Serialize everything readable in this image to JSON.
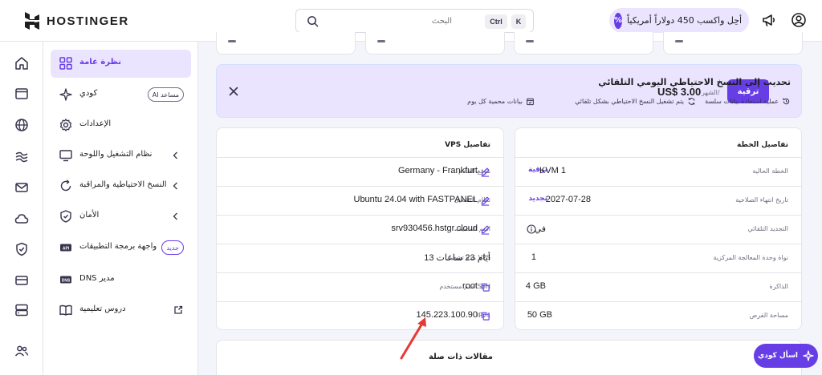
{
  "brand": {
    "name": "HOSTINGER",
    "accent": "#673de6"
  },
  "search": {
    "placeholder": "البحث",
    "shortcut_ctrl": "Ctrl",
    "shortcut_key": "K"
  },
  "promo": {
    "text": "أحِل واكسب 450 دولاراً أمريكياً",
    "icon": "percent-badge-icon"
  },
  "topbar_icons": [
    "megaphone-icon",
    "account-icon"
  ],
  "rail_icons": [
    "home-icon",
    "browser-window-icon",
    "globe-icon",
    "wind-icon",
    "mail-icon",
    "cloud-icon",
    "shield-icon",
    "billing-card-icon",
    "server-icon",
    "users-icon"
  ],
  "sidebar": {
    "items": [
      {
        "label": "نظرة عامة",
        "icon": "overview-grid-icon",
        "active": true
      },
      {
        "label": "كودي",
        "icon": "kodee-sparkle-icon",
        "badge": "مساعد AI"
      },
      {
        "label": "الإعدادات",
        "icon": "settings-gear-icon"
      },
      {
        "label": "نظام التشغيل واللوحة",
        "icon": "monitor-icon",
        "chevron": true
      },
      {
        "label": "النسخ الاحتياطية والمراقبة",
        "icon": "backup-refresh-icon",
        "chevron": true
      },
      {
        "label": "الأمان",
        "icon": "security-shield-icon",
        "chevron": true
      },
      {
        "label": "واجهة برمجة التطبيقات",
        "icon": "api-icon",
        "badge": "جديد"
      },
      {
        "label": "مدير DNS",
        "icon": "dns-icon"
      },
      {
        "label": "دروس تعليمية",
        "icon": "book-icon",
        "external": true
      }
    ]
  },
  "banner": {
    "title": "تحديث إلى النسخ الاحتياطي اليومي التلقائي",
    "features": [
      {
        "text": "عملية استعادة بيانات سلسة",
        "icon": "restore-icon"
      },
      {
        "text": "يتم تشغيل النسخ الاحتياطي بشكل تلقائي",
        "icon": "auto-sync-icon"
      },
      {
        "text": "بيانات محمية كل يوم",
        "icon": "calendar-check-icon"
      }
    ],
    "price": "US$ 3.00",
    "price_period": "/الشهر",
    "button": "ترقية"
  },
  "vps_details": {
    "title": "تفاصيل VPS",
    "rows": [
      {
        "label": "موقع الخادم",
        "value": "Germany - Frankfurt",
        "icon": "edit-pencil-icon"
      },
      {
        "label": "نظام التشغيل",
        "value": "Ubuntu 24.04 with FASTPANEL",
        "icon": "edit-pencil-icon"
      },
      {
        "label": "اسم المضيف",
        "value": "srv930456.hstgr.cloud",
        "icon": "edit-pencil-icon"
      },
      {
        "label": "VPS مدة تشغيل",
        "value": "أيام 23 ساعات 13"
      },
      {
        "label": "SSH اسم مستخدم",
        "value": "root",
        "icon": "copy-icon"
      },
      {
        "label": "IPv4",
        "value": "145.223.100.90",
        "icon": "copy-icon"
      }
    ]
  },
  "plan_details": {
    "title": "تفاصيل الخطة",
    "rows": [
      {
        "label": "الخطة الحالية",
        "value": "KVM 1",
        "action": "ترقية"
      },
      {
        "label": "تاريخ انتهاء الصلاحية",
        "value": "2027-07-28",
        "action": "تجديد"
      },
      {
        "label": "التجديد التلقائي",
        "value": "في",
        "icon": "info-icon"
      },
      {
        "label": "نواة وحدة المعالجة المركزية",
        "value": "1"
      },
      {
        "label": "الذاكرة",
        "value": "4 GB"
      },
      {
        "label": "مساحة القرص",
        "value": "50 GB"
      }
    ]
  },
  "articles": {
    "title": "مقالات ذات صلة"
  },
  "chat": {
    "label": "اسأل كودي"
  }
}
